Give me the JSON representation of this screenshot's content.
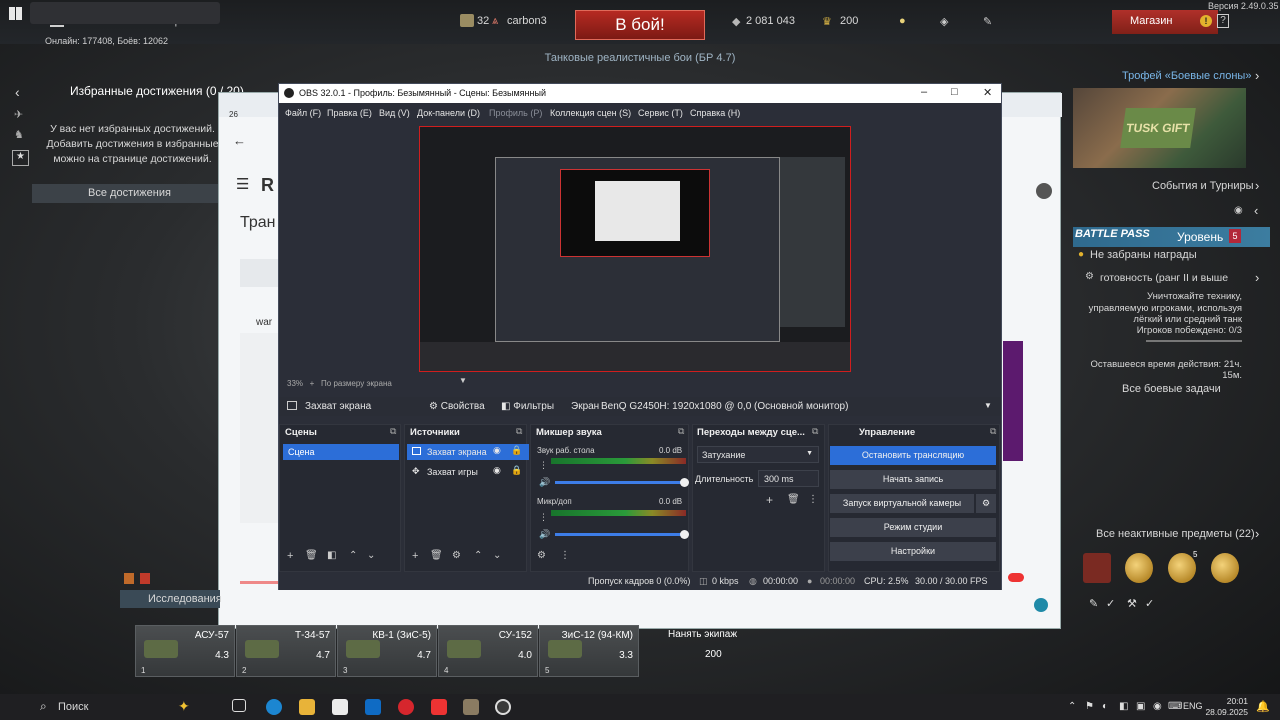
{
  "top_bar": {
    "nav": [
      "Бои",
      "Сообщество"
    ],
    "online_text": "Онлайн: 177408, Боёв: 12062",
    "squad_count": "32",
    "username": "carbon3",
    "battle_button": "В бой!",
    "battle_mode": "Танковые реалистичные бои (БР 4.7)",
    "silver_lions": "2 081 043",
    "gold_eagles": "200",
    "shop_label": "Магазин",
    "shop_alert": "!",
    "version": "Версия 2.49.0.35"
  },
  "achievements": {
    "title": "Избранные достижения (0 / 20)",
    "empty_text": "У вас нет избранных достижений. Добавить достижения в избранные можно на странице достижений.",
    "all_button": "Все достижения"
  },
  "browser_bg": {
    "tab_num": "26",
    "heading": "Тран",
    "side_frag_1": "war",
    "logo_frag": "R"
  },
  "right_panel": {
    "trophy_title": "Трофей «Боевые слоны»",
    "trophy_label": "TUSK GIFT",
    "events": "События и Турниры",
    "battle_pass_logo": "BATTLE PASS",
    "level_label": "Уровень",
    "level_value": "5",
    "rewards_text": "Не забраны награды",
    "task_name": "готовность (ранг II и выше",
    "task_desc": "Уничтожайте технику, управляемую игроками, используя лёгкий или средний танк",
    "task_progress_label": "Игроков побеждено: 0/3",
    "time_left": "Оставшееся время действия: 21ч. 15м.",
    "all_tasks": "Все боевые задачи",
    "inactive_items": "Все неактивные предметы (22)",
    "inactive_counts": [
      "",
      "",
      "5",
      ""
    ]
  },
  "research_label": "Исследования",
  "crew": [
    {
      "name": "АСУ-57",
      "br": "4.3",
      "slot": "1"
    },
    {
      "name": "Т-34-57",
      "br": "4.7",
      "slot": "2"
    },
    {
      "name": "КВ-1 (ЗиС-5)",
      "br": "4.7",
      "slot": "3"
    },
    {
      "name": "СУ-152",
      "br": "4.0",
      "slot": "4"
    },
    {
      "name": "ЗиС-12 (94-КМ)",
      "br": "3.3",
      "slot": "5"
    }
  ],
  "hire_crew": {
    "label": "Нанять экипаж",
    "price": "200"
  },
  "obs": {
    "title": "OBS 32.0.1 - Профиль: Безымянный - Сцены: Безымянный",
    "menu": [
      "Файл (F)",
      "Правка (E)",
      "Вид (V)",
      "Док-панели (D)",
      "Профиль (P)",
      "Коллекция сцен (S)",
      "Сервис (T)",
      "Справка (H)"
    ],
    "zoom": "33%",
    "zoom_mode": "По размеру экрана",
    "source_name": "Захват экрана",
    "properties_btn": "Свойства",
    "filters_btn": "Фильтры",
    "screen_label": "Экран",
    "monitor": "BenQ G2450H: 1920x1080 @ 0,0 (Основной монитор)",
    "docks": {
      "scenes": "Сцены",
      "sources": "Источники",
      "mixer": "Микшер звука",
      "transitions": "Переходы между сце...",
      "controls": "Управление"
    },
    "scenes": [
      "Сцена"
    ],
    "sources": [
      "Захват экрана",
      "Захват игры"
    ],
    "mixer": [
      {
        "name": "Звук раб. стола",
        "db": "0.0 dB"
      },
      {
        "name": "Микр/доп",
        "db": "0.0 dB"
      }
    ],
    "transition": "Затухание",
    "duration_label": "Длительность",
    "duration_value": "300 ms",
    "controls": [
      "Остановить трансляцию",
      "Начать запись",
      "Запуск виртуальной камеры",
      "Режим студии",
      "Настройки"
    ],
    "status": {
      "dropped": "Пропуск кадров 0 (0.0%)",
      "bitrate": "0 kbps",
      "stream_time": "00:00:00",
      "rec_time": "00:00:00",
      "cpu": "CPU: 2.5%",
      "fps": "30.00 / 30.00 FPS"
    }
  },
  "taskbar": {
    "search": "Поиск",
    "lang": "ENG",
    "time": "20:01",
    "date": "28.09.2025"
  }
}
